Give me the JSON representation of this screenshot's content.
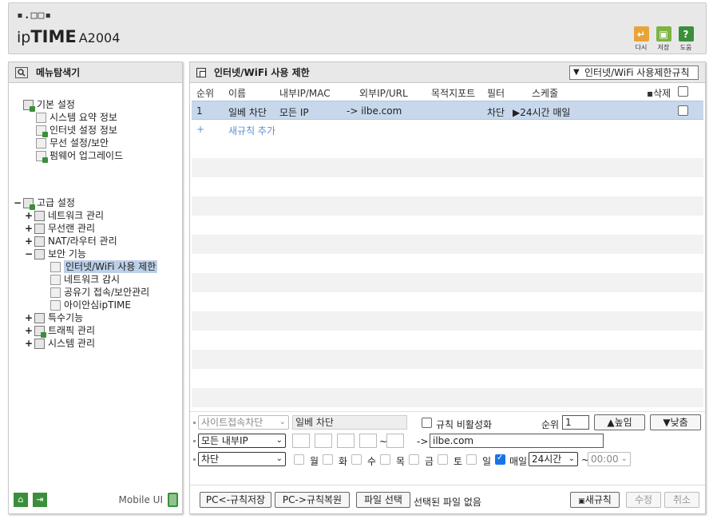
{
  "header": {
    "logo_dots": "▪.□□▪",
    "logo_prefix": "ip",
    "logo_brand": "TIME",
    "model": "A2004",
    "buttons": [
      {
        "label": "다시",
        "icon": "restart-icon",
        "color": "#e8a43a"
      },
      {
        "label": "저장",
        "icon": "save-icon",
        "color": "#7cb342"
      },
      {
        "label": "도움",
        "icon": "help-icon",
        "color": "#3a8f3a"
      }
    ]
  },
  "sidebar": {
    "title": "메뉴탐색기",
    "basic": {
      "label": "기본 설정",
      "items": [
        "시스템 요약 정보",
        "인터넷 설정 정보",
        "무선 설정/보안",
        "펌웨어 업그레이드"
      ]
    },
    "advanced": {
      "toggle": "−",
      "label": "고급 설정",
      "items": [
        {
          "toggle": "+",
          "label": "네트워크 관리"
        },
        {
          "toggle": "+",
          "label": "무선랜 관리"
        },
        {
          "toggle": "+",
          "label": "NAT/라우터 관리"
        },
        {
          "toggle": "−",
          "label": "보안 기능"
        }
      ],
      "security_items": [
        "인터넷/WiFi 사용 제한",
        "네트워크 감시",
        "공유기 접속/보안관리",
        "아이안심ipTIME"
      ],
      "more_items": [
        {
          "toggle": "+",
          "label": "특수기능"
        },
        {
          "toggle": "+",
          "label": "트래픽 관리"
        },
        {
          "toggle": "+",
          "label": "시스템 관리"
        }
      ]
    },
    "mobile_label": "Mobile UI"
  },
  "main": {
    "title": "인터넷/WiFi 사용 제한",
    "rule_select": "인터넷/WiFi 사용제한규칙",
    "columns": [
      "순위",
      "이름",
      "내부IP/MAC",
      "외부IP/URL",
      "목적지포트",
      "필터",
      "스케줄",
      "삭제"
    ],
    "rule": {
      "rank": "1",
      "name": "일베 차단",
      "internal": "모든 IP",
      "external": "-> ilbe.com",
      "port": "",
      "filter": "차단",
      "schedule": "▶24시간 매일"
    },
    "add_plus": "+",
    "add_label": "새규칙 추가",
    "form": {
      "type_select": "사이트접속차단",
      "name_value": "일베 차단",
      "disable_label": "규칙 비활성화",
      "rank_label": "순위",
      "rank_value": "1",
      "up_button": "▲높임",
      "down_button": "▼낮춤",
      "ip_select": "모든 내부IP",
      "arrow": "->",
      "url_value": "ilbe.com",
      "filter_select": "차단",
      "days": [
        "월",
        "화",
        "수",
        "목",
        "금",
        "토",
        "일"
      ],
      "everyday_label": "매일",
      "hours_select": "24시간",
      "tilde": "~",
      "time_select": "00:00",
      "ip_tilde": "~"
    },
    "bottom": {
      "save_pc": "PC<-규칙저장",
      "restore_pc": "PC->규칙복원",
      "file_select": "파일 선택",
      "file_none": "선택된 파일 없음",
      "new_rule": "새규칙",
      "modify": "수정",
      "cancel": "취소"
    }
  }
}
